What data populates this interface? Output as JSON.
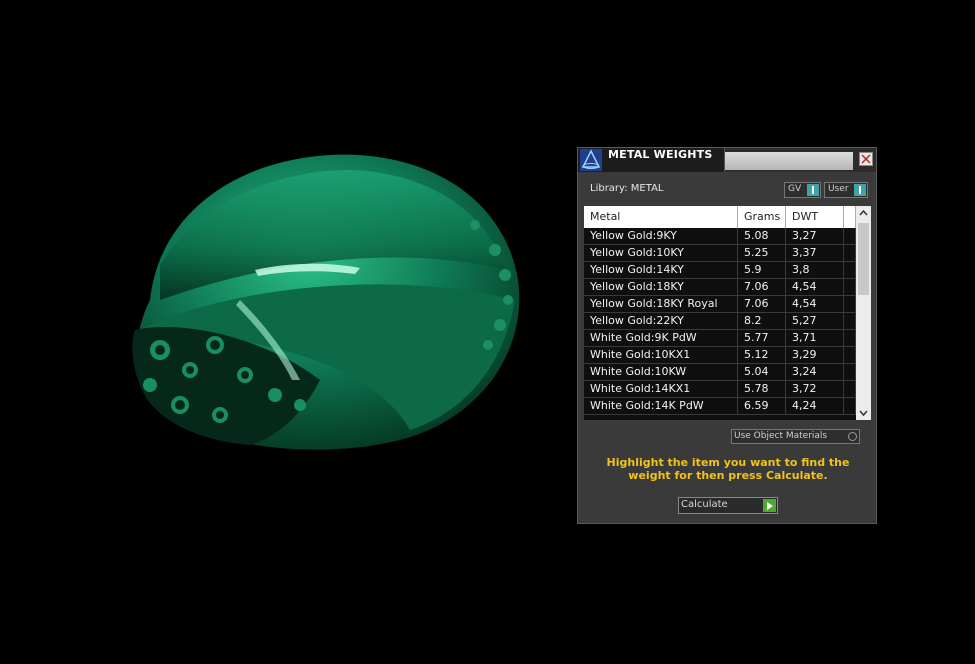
{
  "viewport": {
    "object": "ring-3d-model",
    "color": "#0f7a55"
  },
  "panel": {
    "title": "METAL WEIGHTS",
    "library_label": "Library: METAL",
    "toggles": {
      "gv": "GV",
      "user": "User"
    },
    "columns": {
      "metal": "Metal",
      "grams": "Grams",
      "dwt": "DWT"
    },
    "rows": [
      {
        "metal": "Yellow Gold:9KY",
        "grams": "5.08",
        "dwt": "3,27"
      },
      {
        "metal": "Yellow Gold:10KY",
        "grams": "5.25",
        "dwt": "3,37"
      },
      {
        "metal": "Yellow Gold:14KY",
        "grams": "5.9",
        "dwt": "3,8"
      },
      {
        "metal": "Yellow Gold:18KY",
        "grams": "7.06",
        "dwt": "4,54"
      },
      {
        "metal": "Yellow Gold:18KY Royal",
        "grams": "7.06",
        "dwt": "4,54"
      },
      {
        "metal": "Yellow Gold:22KY",
        "grams": "8.2",
        "dwt": "5,27"
      },
      {
        "metal": "White Gold:9K PdW",
        "grams": "5.77",
        "dwt": "3,71"
      },
      {
        "metal": "White Gold:10KX1",
        "grams": "5.12",
        "dwt": "3,29"
      },
      {
        "metal": "White Gold:10KW",
        "grams": "5.04",
        "dwt": "3,24"
      },
      {
        "metal": "White Gold:14KX1",
        "grams": "5.78",
        "dwt": "3,72"
      },
      {
        "metal": "White Gold:14K PdW",
        "grams": "6.59",
        "dwt": "4,24"
      }
    ],
    "use_object_materials": "Use Object Materials",
    "hint": "Highlight the item you want to find the weight for then press Calculate.",
    "calculate_label": "Calculate",
    "colors": {
      "hint": "#f0c419",
      "accent": "#3fa3a8",
      "go": "#4ea832"
    }
  }
}
